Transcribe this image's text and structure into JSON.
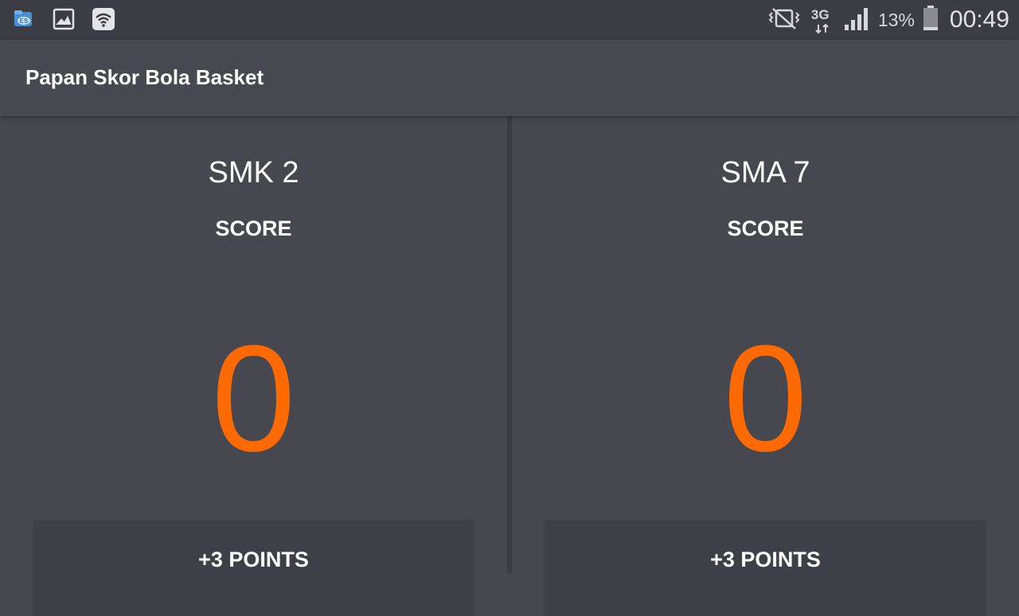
{
  "status_bar": {
    "left_icons": [
      "file-manager-icon",
      "image-icon",
      "wifi-icon"
    ],
    "right_icons": [
      "vibrate-mute-icon",
      "network-3g-icon",
      "signal-icon",
      "battery-icon"
    ],
    "network_type": "3G",
    "battery_percent": "13%",
    "time": "00:49"
  },
  "app_bar": {
    "title": "Papan Skor Bola Basket"
  },
  "teams": [
    {
      "name": "SMK 2",
      "score_label": "SCORE",
      "score": "0",
      "button_label": "+3 POINTS"
    },
    {
      "name": "SMA 7",
      "score_label": "SCORE",
      "score": "0",
      "button_label": "+3 POINTS"
    }
  ],
  "colors": {
    "score": "#ff6a00",
    "background": "#474750",
    "status_bar": "#3c3c45",
    "button": "#3f3f47"
  }
}
